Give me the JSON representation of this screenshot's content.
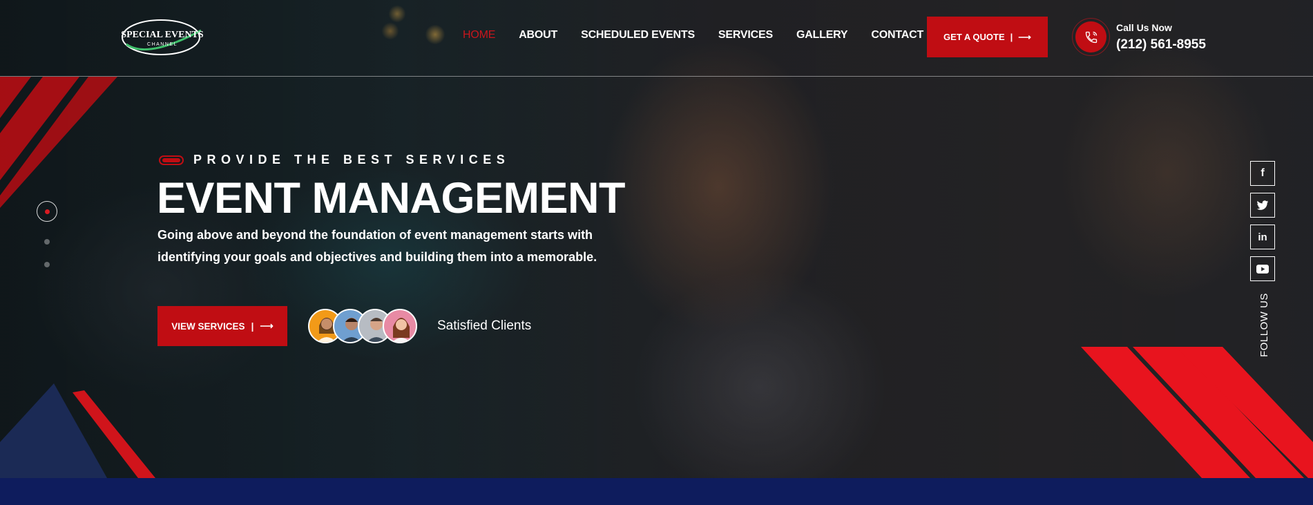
{
  "brand": {
    "logo_line1": "SPECIAL EVENTS",
    "logo_line2": "CHANNEL"
  },
  "nav": {
    "items": [
      "HOME",
      "ABOUT",
      "SCHEDULED EVENTS",
      "SERVICES",
      "GALLERY",
      "CONTACT"
    ],
    "active": "HOME"
  },
  "header": {
    "quote_label": "GET A QUOTE",
    "quote_separator": "|",
    "call_label": "Call Us Now",
    "call_number": "(212) 561-8955"
  },
  "hero": {
    "eyebrow": "PROVIDE THE BEST SERVICES",
    "title": "EVENT MANAGEMENT",
    "description": "Going above and beyond the foundation of event management starts with identifying your goals and objectives and building them into a memorable.",
    "cta_label": "VIEW SERVICES",
    "cta_separator": "|",
    "clients_label": "Satisfied Clients",
    "slider_index": 1,
    "slider_total": 3
  },
  "social": {
    "items": [
      {
        "name": "facebook-icon",
        "glyph": "f"
      },
      {
        "name": "twitter-icon",
        "glyph": "🐦"
      },
      {
        "name": "linkedin-icon",
        "glyph": "in"
      },
      {
        "name": "youtube-icon",
        "glyph": "▶"
      }
    ],
    "follow_label": "FOLLOW US"
  },
  "colors": {
    "accent": "#c00d13",
    "navy": "#0e1c5d"
  }
}
